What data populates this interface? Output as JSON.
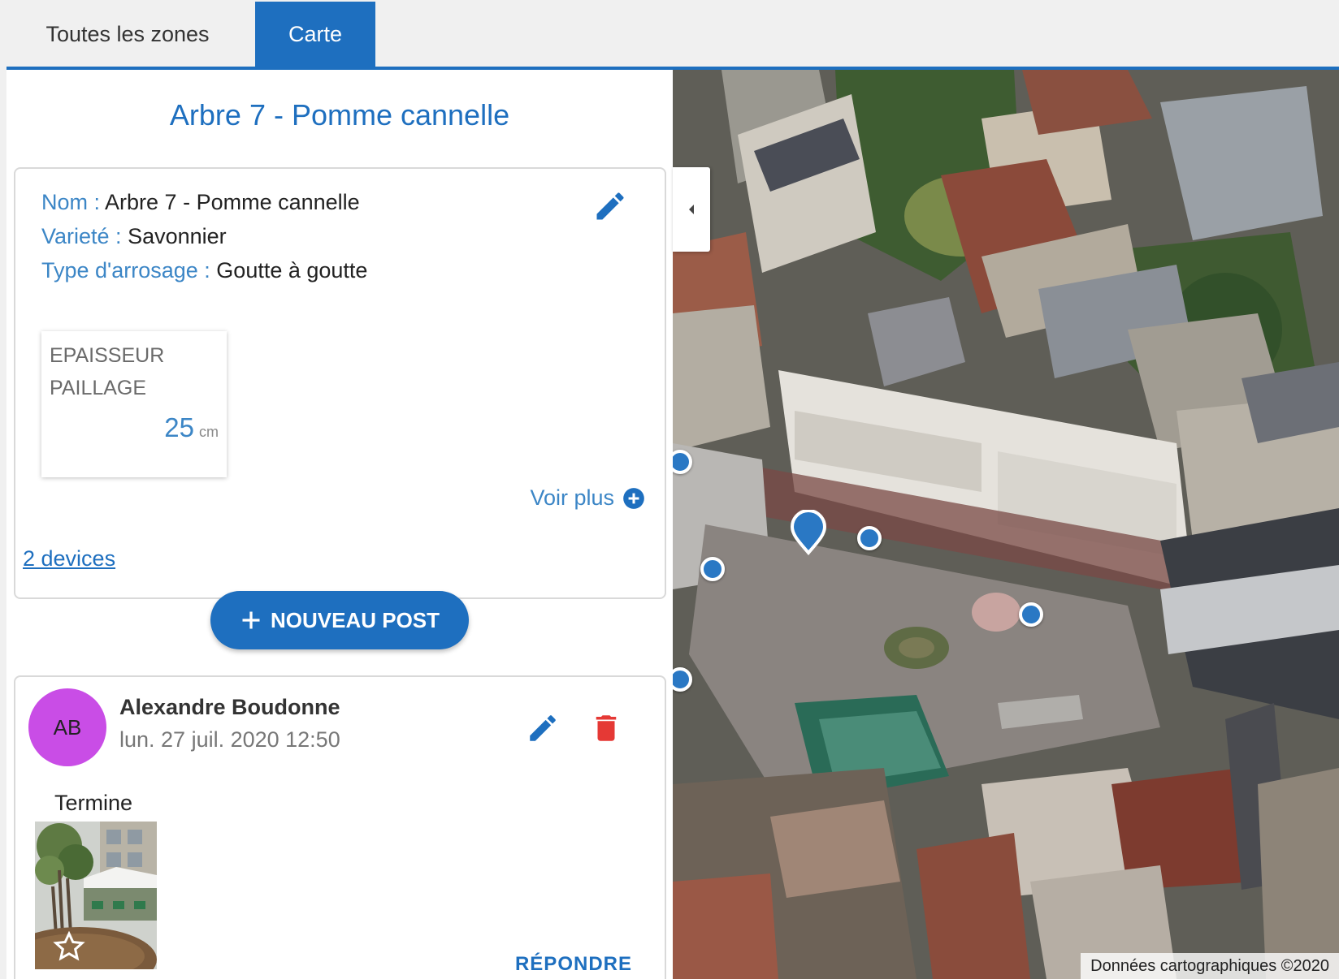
{
  "tabs": [
    {
      "label": "Toutes les zones",
      "active": false
    },
    {
      "label": "Carte",
      "active": true
    }
  ],
  "tree": {
    "title": "Arbre 7 - Pomme cannelle",
    "fields": [
      {
        "label": "Nom :",
        "value": "Arbre 7 - Pomme cannelle"
      },
      {
        "label": "Varieté :",
        "value": "Savonnier"
      },
      {
        "label": "Type d'arrosage :",
        "value": "Goutte à goutte"
      }
    ],
    "metric": {
      "label": "EPAISSEUR PAILLAGE",
      "value": "25",
      "unit": "cm"
    },
    "more_label": "Voir plus"
  },
  "devices_link": "2 devices",
  "new_post_label": "NOUVEAU POST",
  "post": {
    "initials": "AB",
    "avatar_color": "#c94de6",
    "author": "Alexandre Boudonne",
    "date": "lun. 27 juil. 2020 12:50",
    "text": "Termine",
    "reply_label": "RÉPONDRE"
  },
  "map": {
    "attribution": "Données cartographiques ©2020",
    "markers": 6
  },
  "colors": {
    "accent": "#1e6fbf",
    "label": "#3c86c6",
    "delete": "#e53935"
  },
  "icons": [
    "edit-icon",
    "plus-circle-icon",
    "plus-icon",
    "delete-icon",
    "star-icon",
    "chevron-left-icon",
    "map-pin-icon"
  ]
}
